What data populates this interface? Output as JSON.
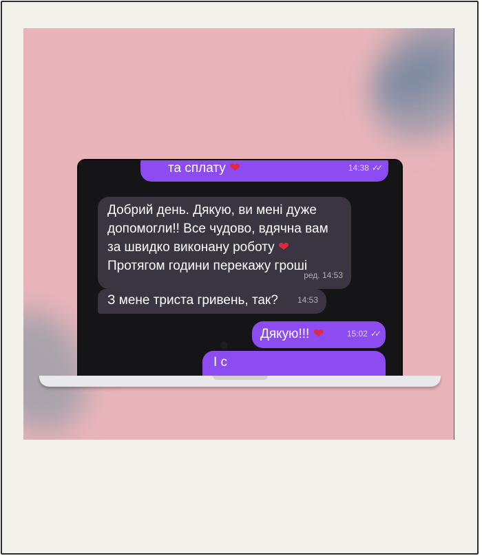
{
  "messages": [
    {
      "text": "та сплату",
      "emoji": "❤",
      "time": "14:38",
      "read": "✓✓"
    },
    {
      "line1": "Добрий день. Дякую, ви мені дуже",
      "line2": "допомогли!! Все чудово, вдячна вам",
      "line3": "за швидко виконану роботу",
      "emoji": "❤",
      "line4": "Протягом години перекажу гроші",
      "time": "ред. 14:53"
    },
    {
      "text": "З мене триста гривень, так?",
      "time": "14:53"
    },
    {
      "text": "Дякую!!!",
      "emoji": "❤",
      "time": "15:02",
      "read": "✓✓"
    },
    {
      "text": "І с"
    }
  ],
  "colors": {
    "outgoing": "#8d4cf2",
    "incoming": "#3a3540",
    "background": "#e8b4ba"
  }
}
